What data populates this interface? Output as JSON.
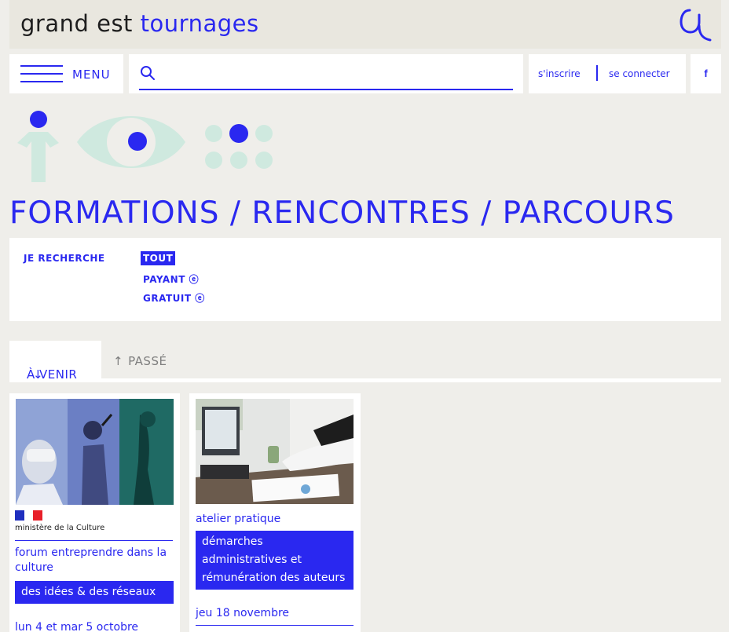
{
  "header": {
    "logo_part1": "grand est",
    "logo_part2": "tournages",
    "menu_label": "MENU",
    "search_placeholder": "",
    "register_label": "s'inscrire",
    "login_label": "se connecter",
    "facebook_label": "f"
  },
  "page": {
    "title": "FORMATIONS / RENCONTRES / PARCOURS"
  },
  "filters": {
    "label": "JE RECHERCHE",
    "options": [
      "TOUT",
      "PAYANT ⓔ",
      "GRATUIT ⓔ"
    ],
    "selected": "TOUT"
  },
  "tabs": {
    "upcoming": "À VENIR",
    "past": "PASSÉ"
  },
  "cards": [
    {
      "ministry": "ministère de la Culture",
      "title": "forum entreprendre dans la culture",
      "subtitle": "des idées & des réseaux",
      "date": "lun 4 et mar 5 octobre"
    },
    {
      "category": "atelier pratique",
      "title": "démarches administratives et rémunération des auteurs",
      "date": "jeu 18 novembre"
    }
  ],
  "colors": {
    "accent": "#2a28f0",
    "background": "#efeeea",
    "mint": "#cfe9df",
    "header_bg": "#e9e7df"
  }
}
